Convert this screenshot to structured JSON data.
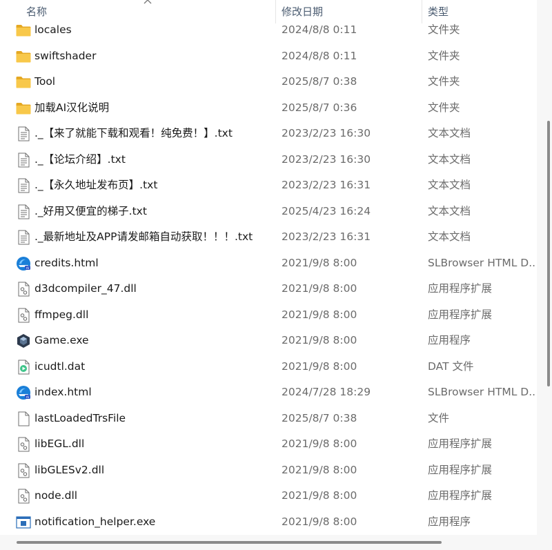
{
  "columns": {
    "name": "名称",
    "date": "修改日期",
    "type": "类型"
  },
  "files": [
    {
      "icon": "folder-icon",
      "name": "locales",
      "date": "2024/8/8 0:11",
      "type": "文件夹"
    },
    {
      "icon": "folder-icon",
      "name": "swiftshader",
      "date": "2024/8/8 0:11",
      "type": "文件夹"
    },
    {
      "icon": "folder-icon",
      "name": "Tool",
      "date": "2025/8/7 0:38",
      "type": "文件夹"
    },
    {
      "icon": "folder-icon",
      "name": "加载AI汉化说明",
      "date": "2025/8/7 0:36",
      "type": "文件夹"
    },
    {
      "icon": "text-file-icon",
      "name": "._【来了就能下载和观看！纯免费！】.txt",
      "date": "2023/2/23 16:30",
      "type": "文本文档"
    },
    {
      "icon": "text-file-icon",
      "name": "._【论坛介绍】.txt",
      "date": "2023/2/23 16:30",
      "type": "文本文档"
    },
    {
      "icon": "text-file-icon",
      "name": "._【永久地址发布页】.txt",
      "date": "2023/2/23 16:31",
      "type": "文本文档"
    },
    {
      "icon": "text-file-icon",
      "name": "._好用又便宜的梯子.txt",
      "date": "2025/4/23 16:24",
      "type": "文本文档"
    },
    {
      "icon": "text-file-icon",
      "name": "._最新地址及APP请发邮箱自动获取！！！.txt",
      "date": "2023/2/23 16:31",
      "type": "文本文档"
    },
    {
      "icon": "browser-html-icon",
      "name": "credits.html",
      "date": "2021/9/8 8:00",
      "type": "SLBrowser HTML D..."
    },
    {
      "icon": "dll-file-icon",
      "name": "d3dcompiler_47.dll",
      "date": "2021/9/8 8:00",
      "type": "应用程序扩展"
    },
    {
      "icon": "dll-file-icon",
      "name": "ffmpeg.dll",
      "date": "2021/9/8 8:00",
      "type": "应用程序扩展"
    },
    {
      "icon": "game-exe-icon",
      "name": "Game.exe",
      "date": "2021/9/8 8:00",
      "type": "应用程序"
    },
    {
      "icon": "media-dat-icon",
      "name": "icudtl.dat",
      "date": "2021/9/8 8:00",
      "type": "DAT 文件"
    },
    {
      "icon": "browser-html-icon",
      "name": "index.html",
      "date": "2024/7/28 18:29",
      "type": "SLBrowser HTML D..."
    },
    {
      "icon": "blank-file-icon",
      "name": "lastLoadedTrsFile",
      "date": "2025/8/7 0:38",
      "type": "文件"
    },
    {
      "icon": "dll-file-icon",
      "name": "libEGL.dll",
      "date": "2021/9/8 8:00",
      "type": "应用程序扩展"
    },
    {
      "icon": "dll-file-icon",
      "name": "libGLESv2.dll",
      "date": "2021/9/8 8:00",
      "type": "应用程序扩展"
    },
    {
      "icon": "dll-file-icon",
      "name": "node.dll",
      "date": "2021/9/8 8:00",
      "type": "应用程序扩展"
    },
    {
      "icon": "app-exe-icon",
      "name": "notification_helper.exe",
      "date": "2021/9/8 8:00",
      "type": "应用程序"
    }
  ],
  "colors": {
    "folder": "#f5c242",
    "folder_dark": "#e5a823",
    "header_text": "#4a5b70",
    "scroll_thumb": "#8a8a8a"
  }
}
